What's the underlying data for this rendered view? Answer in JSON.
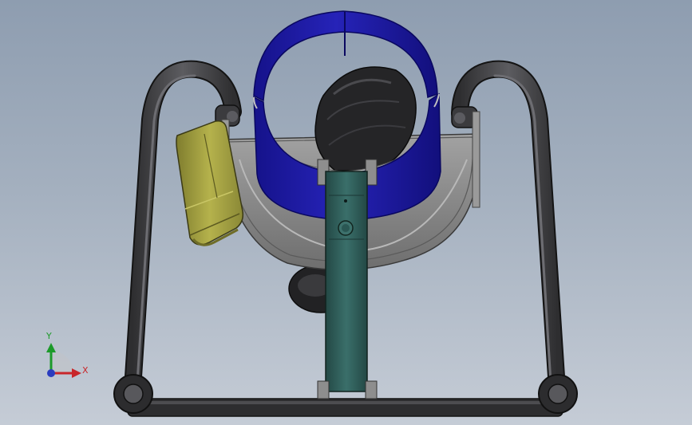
{
  "viewport": {
    "background_top": "#8e9db0",
    "background_bottom": "#c5ccd6"
  },
  "triad": {
    "y_label": "Y",
    "x_label": "X",
    "y_color": "#1c9a2a",
    "x_color": "#c8262a",
    "origin_color": "#2a3cbf"
  },
  "model": {
    "frame_color": "#4a4a4c",
    "housing_color": "#8a8a8a",
    "ring_color": "#1a17a0",
    "impeller_color": "#262628",
    "arm_color": "#2f5e5a",
    "motor_color": "#9c9a3e",
    "parts": [
      "frame",
      "base-bar",
      "housing",
      "blue-ring",
      "impeller",
      "support-arm",
      "motor"
    ]
  }
}
